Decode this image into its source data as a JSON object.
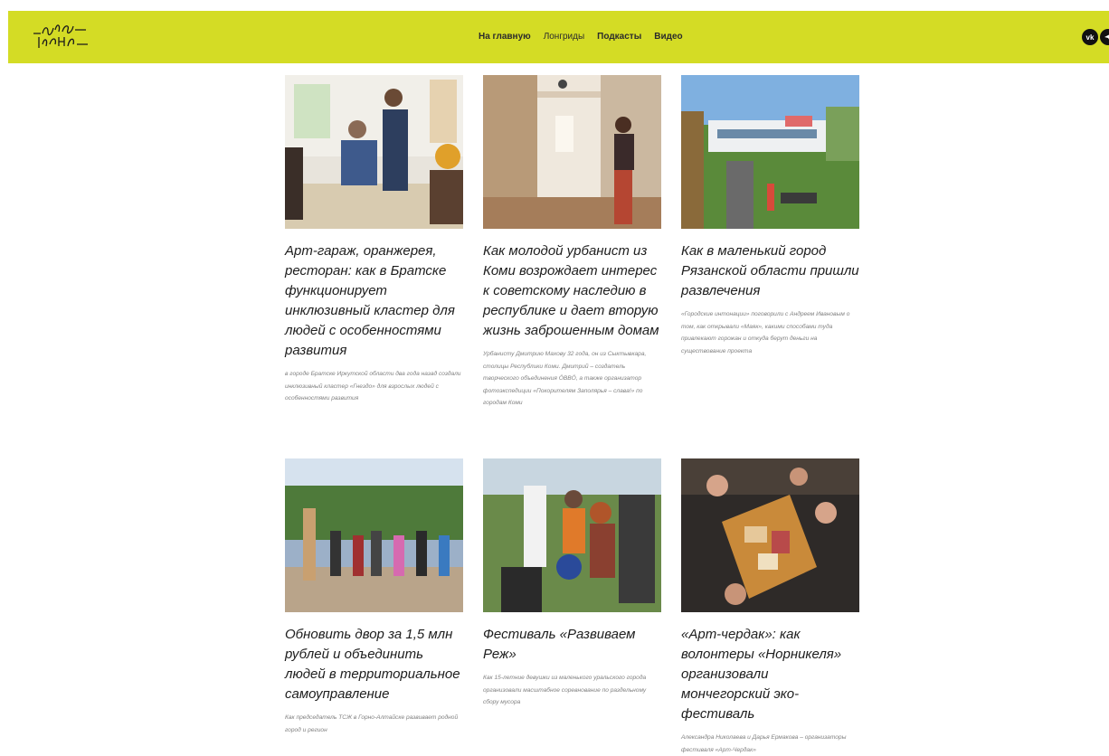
{
  "nav": {
    "items": [
      "На главную",
      "Лонгриды",
      "Подкасты",
      "Видео"
    ]
  },
  "social": {
    "vk_icon": "vk-icon",
    "telegram_icon": "telegram-icon"
  },
  "colors": {
    "header_bg": "#d4dc25"
  },
  "cards": [
    {
      "title": "Арт-гараж, оранжерея, ресторан: как в Братске функционирует инклюзивный кластер для людей с особенностями развития",
      "desc": "в городе Братске Иркутской области два года назад создали инклюзивный кластер «Гнездо» для взрослых людей с особенностями развития"
    },
    {
      "title": "Как молодой урбанист из Коми возрождает интерес к советскому наследию в республике и дает вторую жизнь заброшенным домам",
      "desc": "Урбанисту Дмитрию Махову 32 года, он из Сыктывкара, столицы Республики Коми. Дмитрий – создатель творческого объединения ÖВВÖ, а также организатор фотоэкспедиции «Покорителям Заполярья – слава!» по городам Коми"
    },
    {
      "title": "Как в маленький город Рязанской области пришли развлечения",
      "desc": "«Городские интонации» поговорили с Андреем Ивановым о том, как открывали «Маяк», какими способами туда привлекают горожан и откуда берут деньги на существование проекта"
    },
    {
      "title": "Обновить двор за 1,5 млн рублей и объединить людей в территориальное самоуправление",
      "desc": "Как председатель ТСЖ в Горно-Алтайске развивает родной город и регион"
    },
    {
      "title": "Фестиваль «Развиваем Реж»",
      "desc": "Как 15-летние девушки из маленького уральского города организовали масштабное соревнование по раздельному сбору мусора"
    },
    {
      "title": "«Арт-чердак»: как волонтеры «Норникеля» организовали мончегорский эко-фестиваль",
      "desc": "Александра Николаева и Дарья Ермакова – организаторы фестиваля «Арт-Чердак»"
    }
  ]
}
